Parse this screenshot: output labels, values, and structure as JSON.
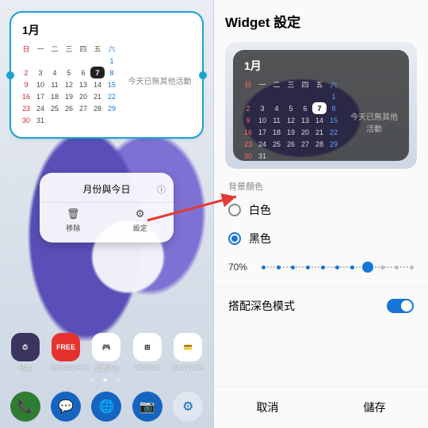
{
  "calendar": {
    "month_label": "1月",
    "dow": [
      "日",
      "一",
      "二",
      "三",
      "四",
      "五",
      "六"
    ],
    "weeks": [
      [
        "",
        "",
        "",
        "",
        "",
        "",
        "1"
      ],
      [
        "2",
        "3",
        "4",
        "5",
        "6",
        "7",
        "8"
      ],
      [
        "9",
        "10",
        "11",
        "12",
        "13",
        "14",
        "15"
      ],
      [
        "16",
        "17",
        "18",
        "19",
        "20",
        "21",
        "22"
      ],
      [
        "23",
        "24",
        "25",
        "26",
        "27",
        "28",
        "29"
      ],
      [
        "30",
        "31",
        "",
        "",
        "",
        "",
        ""
      ]
    ],
    "today": "7",
    "no_events": "今天已無其他活動"
  },
  "popup": {
    "title": "月份與今日",
    "remove": "移除",
    "settings": "設定"
  },
  "apps": {
    "row": [
      {
        "label": "時鐘",
        "bg": "#3a3560",
        "txt": "⏱"
      },
      {
        "label": "Samsung Free",
        "bg": "#e6322f",
        "txt": "FREE"
      },
      {
        "label": "遊戲中心",
        "bg": "#ffffff",
        "txt": "🎮"
      },
      {
        "label": "Microsoft",
        "bg": "#ffffff",
        "txt": "⊞"
      },
      {
        "label": "Easy Wallet",
        "bg": "#ffffff",
        "txt": "💳"
      }
    ],
    "dock": [
      {
        "bg": "#2e7d32",
        "txt": "📞"
      },
      {
        "bg": "#1565c0",
        "txt": "💬"
      },
      {
        "bg": "#1565c0",
        "txt": "🌐"
      },
      {
        "bg": "#1565c0",
        "txt": "📷"
      },
      {
        "bg": "#e0e6ef",
        "txt": "⚙",
        "fg": "#1565c0"
      }
    ]
  },
  "right": {
    "header": "Widget 設定",
    "section_bg": "背景顏色",
    "opt_white": "白色",
    "opt_black": "黑色",
    "opacity_label": "70%",
    "opacity_steps": 11,
    "opacity_index": 7,
    "dark_mode": "搭配深色模式",
    "cancel": "取消",
    "save": "儲存"
  }
}
